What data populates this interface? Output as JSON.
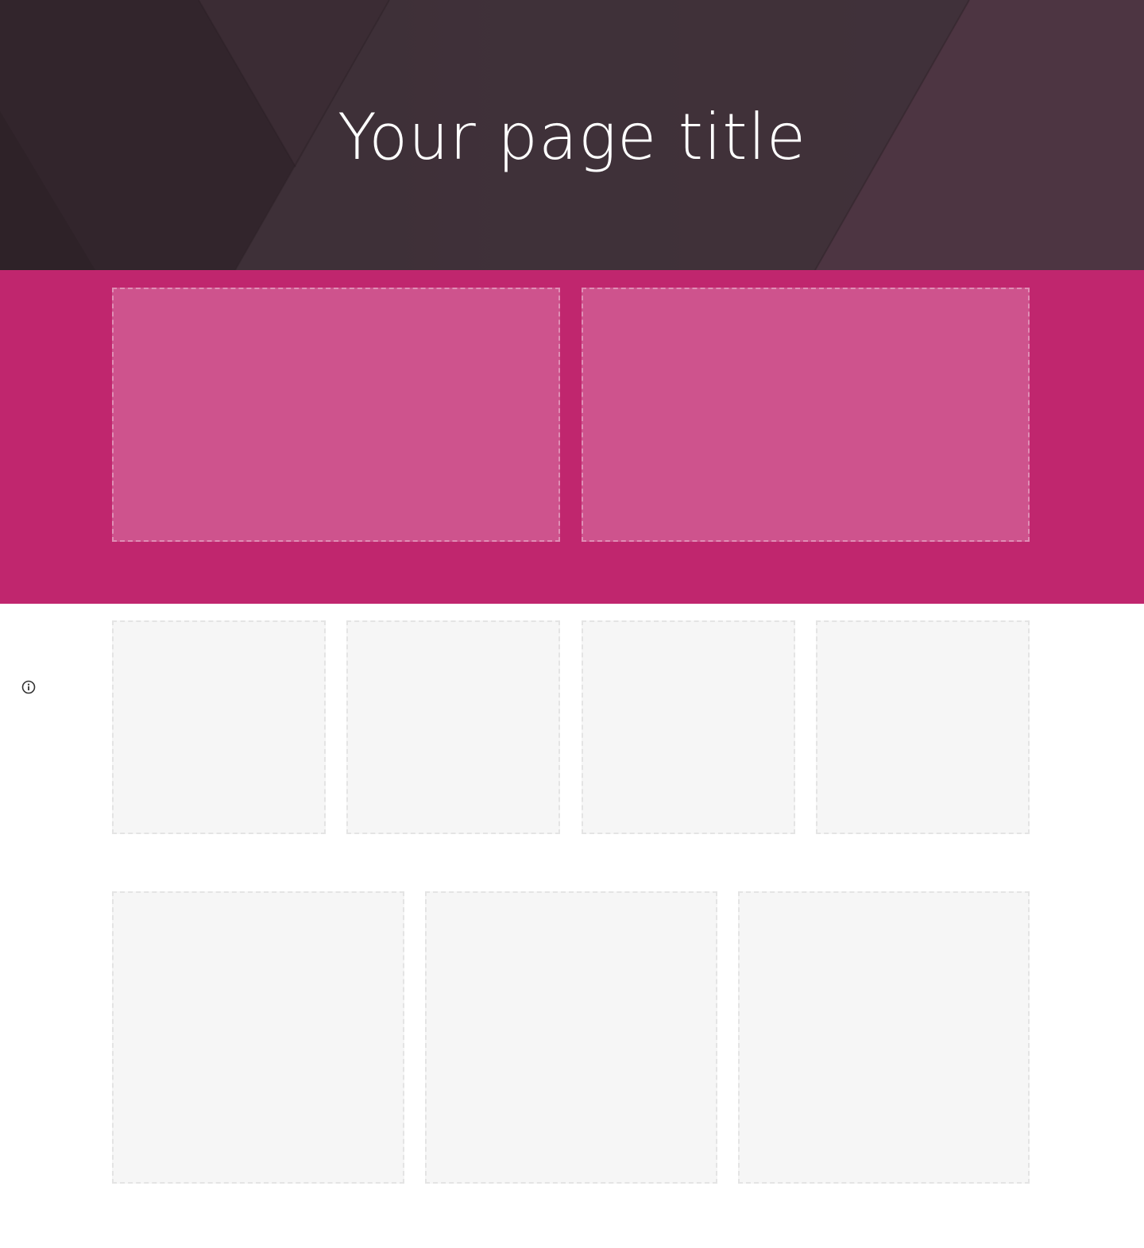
{
  "hero": {
    "title": "Your page title"
  },
  "colors": {
    "hero_base": "#3e2f37",
    "band_background": "#c0266e",
    "band_card": "#ce538d",
    "grey_card": "#f6f6f6",
    "grey_card_border": "#e4e4e4"
  },
  "icons": {
    "info": "info-icon"
  }
}
